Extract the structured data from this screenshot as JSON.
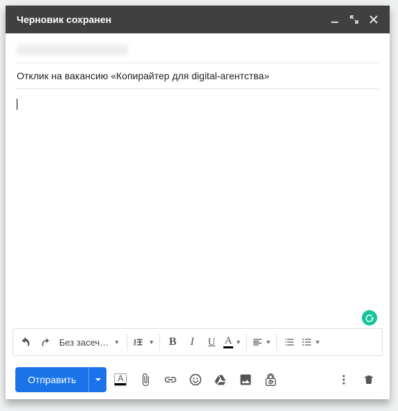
{
  "titlebar": {
    "title": "Черновик сохранен"
  },
  "fields": {
    "subject": "Отклик на вакансию «Копирайтер для digital-агентства»"
  },
  "toolbar": {
    "font_label": "Без засеч…"
  },
  "send": {
    "label": "Отправить"
  }
}
